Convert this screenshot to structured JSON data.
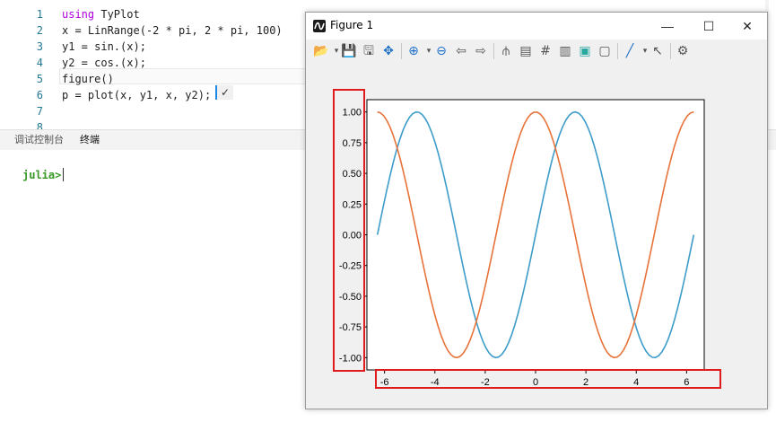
{
  "editor": {
    "lines": [
      {
        "num": "1",
        "tokens": [
          {
            "t": "using",
            "c": "kw"
          },
          {
            "t": " TyPlot",
            "c": "tok"
          }
        ]
      },
      {
        "num": "2",
        "tokens": [
          {
            "t": "x = LinRange(-2 * pi, 2 * pi, 100)",
            "c": "tok"
          }
        ]
      },
      {
        "num": "3",
        "tokens": [
          {
            "t": "y1 = sin.(x);",
            "c": "tok"
          }
        ]
      },
      {
        "num": "4",
        "tokens": [
          {
            "t": "y2 = cos.(x);",
            "c": "tok"
          }
        ]
      },
      {
        "num": "5",
        "tokens": [
          {
            "t": "figure()",
            "c": "tok"
          }
        ]
      },
      {
        "num": "6",
        "tokens": [
          {
            "t": "p = plot(x, y1, x, y2);",
            "c": "tok"
          }
        ]
      },
      {
        "num": "7",
        "tokens": []
      },
      {
        "num": "8",
        "tokens": []
      }
    ],
    "inline_result": "✓"
  },
  "panel": {
    "tabs": [
      "调试控制台",
      "终端"
    ],
    "active_tab": 1
  },
  "terminal": {
    "prompt": "julia>"
  },
  "figure_window": {
    "title": "Figure 1",
    "minimize": "—",
    "maximize": "☐",
    "close": "✕",
    "toolbar_icons": [
      "folder-open-icon",
      "dropdown-arrow-icon",
      "save-icon",
      "save-all-icon",
      "pan-icon",
      "zoom-in-icon",
      "dropdown-arrow-icon",
      "zoom-out-icon",
      "back-arrow-icon",
      "forward-arrow-icon",
      "data-cursor-icon",
      "legend-icon",
      "grid-icon",
      "colorbar-icon",
      "fill-color-icon",
      "frame-icon",
      "line-style-icon",
      "dropdown-arrow-icon",
      "select-pointer-icon",
      "settings-gear-icon"
    ]
  },
  "chart_data": {
    "type": "line",
    "xlim": [
      -6.7,
      6.7
    ],
    "ylim": [
      -1.1,
      1.1
    ],
    "xticks": [
      -6,
      -4,
      -2,
      0,
      2,
      4,
      6
    ],
    "yticks": [
      1.0,
      0.75,
      0.5,
      0.25,
      0.0,
      -0.25,
      -0.5,
      -0.75,
      -1.0
    ],
    "ytick_labels": [
      "1.00",
      "0.75",
      "0.50",
      "0.25",
      "0.00",
      "-0.25",
      "-0.50",
      "-0.75",
      "-1.00"
    ],
    "xtick_labels": [
      "-6",
      "-4",
      "-2",
      "0",
      "2",
      "4",
      "6"
    ],
    "x_range": [
      -6.283,
      6.283
    ],
    "series": [
      {
        "func": "sin",
        "color": "#3d9cc9",
        "points": 100
      },
      {
        "func": "cos",
        "color": "#e8733a",
        "points": 100
      }
    ],
    "grid": false
  },
  "highlight_color": "#e01b1b"
}
